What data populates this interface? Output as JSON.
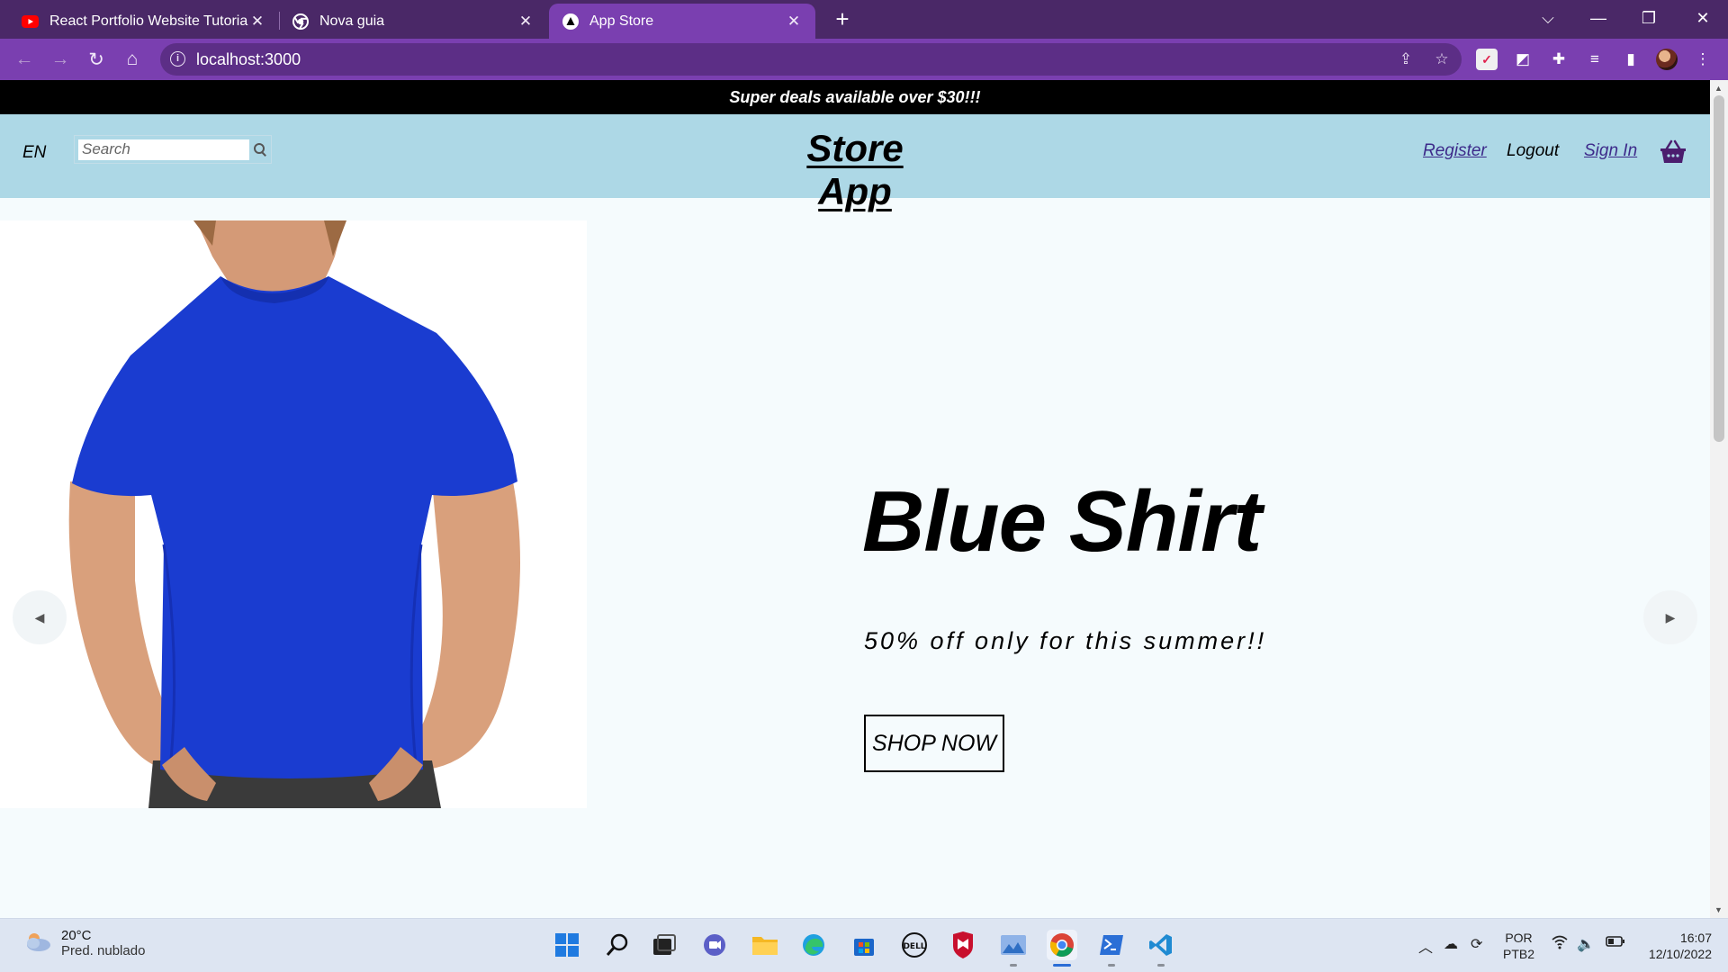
{
  "browser": {
    "tabs": [
      {
        "title": "React Portfolio Website Tutorial |",
        "favicon": "youtube-icon",
        "active": false
      },
      {
        "title": "Nova guia",
        "favicon": "chrome-icon",
        "active": false
      },
      {
        "title": "App Store",
        "favicon": "app-store-icon",
        "active": true
      }
    ],
    "new_tab": "+",
    "address": "localhost:3000",
    "accent_color": "#7a3fb0",
    "frame_color": "#4a2867"
  },
  "page": {
    "announcement": "Super deals available over $30!!!",
    "nav": {
      "language": "EN",
      "search_placeholder": "Search",
      "logo": "Store App",
      "register": "Register",
      "logout": "Logout",
      "sign_in": "Sign In",
      "cart_icon": "shopping-basket-icon"
    },
    "slide": {
      "title": "Blue Shirt",
      "description": "50% off only for this summer!!",
      "button": "SHOP NOW",
      "image": "man-in-blue-t-shirt",
      "shirt_color": "#1a3cd0"
    },
    "colors": {
      "announcement_bg": "#000000",
      "navbar_bg": "#add8e6",
      "page_bg": "#f5fbfd"
    }
  },
  "taskbar": {
    "weather_temp": "20°C",
    "weather_desc": "Pred. nublado",
    "apps": [
      "start",
      "search",
      "task-view",
      "teams-chat",
      "file-explorer",
      "edge",
      "microsoft-store",
      "dell",
      "mcafee",
      "photos",
      "chrome",
      "powershell",
      "vscode"
    ],
    "language_line1": "POR",
    "language_line2": "PTB2",
    "time": "16:07",
    "date": "12/10/2022"
  }
}
